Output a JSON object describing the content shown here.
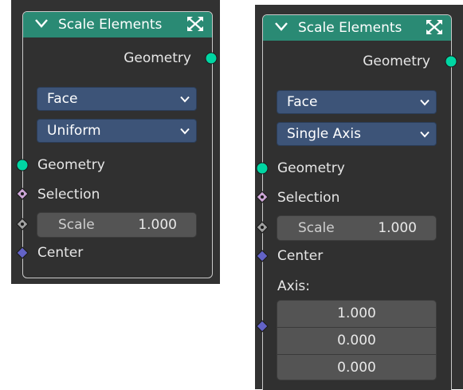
{
  "nodes": [
    {
      "title": "Scale Elements",
      "output_label": "Geometry",
      "domain_dropdown": "Face",
      "mode_dropdown": "Uniform",
      "inputs": {
        "geometry": "Geometry",
        "selection": "Selection",
        "scale_label": "Scale",
        "scale_value": "1.000",
        "center": "Center"
      }
    },
    {
      "title": "Scale Elements",
      "output_label": "Geometry",
      "domain_dropdown": "Face",
      "mode_dropdown": "Single Axis",
      "inputs": {
        "geometry": "Geometry",
        "selection": "Selection",
        "scale_label": "Scale",
        "scale_value": "1.000",
        "center": "Center",
        "axis_label": "Axis:",
        "axis_values": [
          "1.000",
          "0.000",
          "0.000"
        ]
      }
    }
  ],
  "colors": {
    "header": "#2a8a74",
    "geometry_socket": "#00d6a3",
    "selection_socket": "#cca6d6",
    "float_socket": "#a1a1a1",
    "vector_socket": "#6363c7",
    "dropdown": "#3d5478"
  },
  "icons": {
    "collapse": "chevron-down-icon",
    "expand": "expand-arrows-icon",
    "dropdown": "chevron-down-icon"
  }
}
